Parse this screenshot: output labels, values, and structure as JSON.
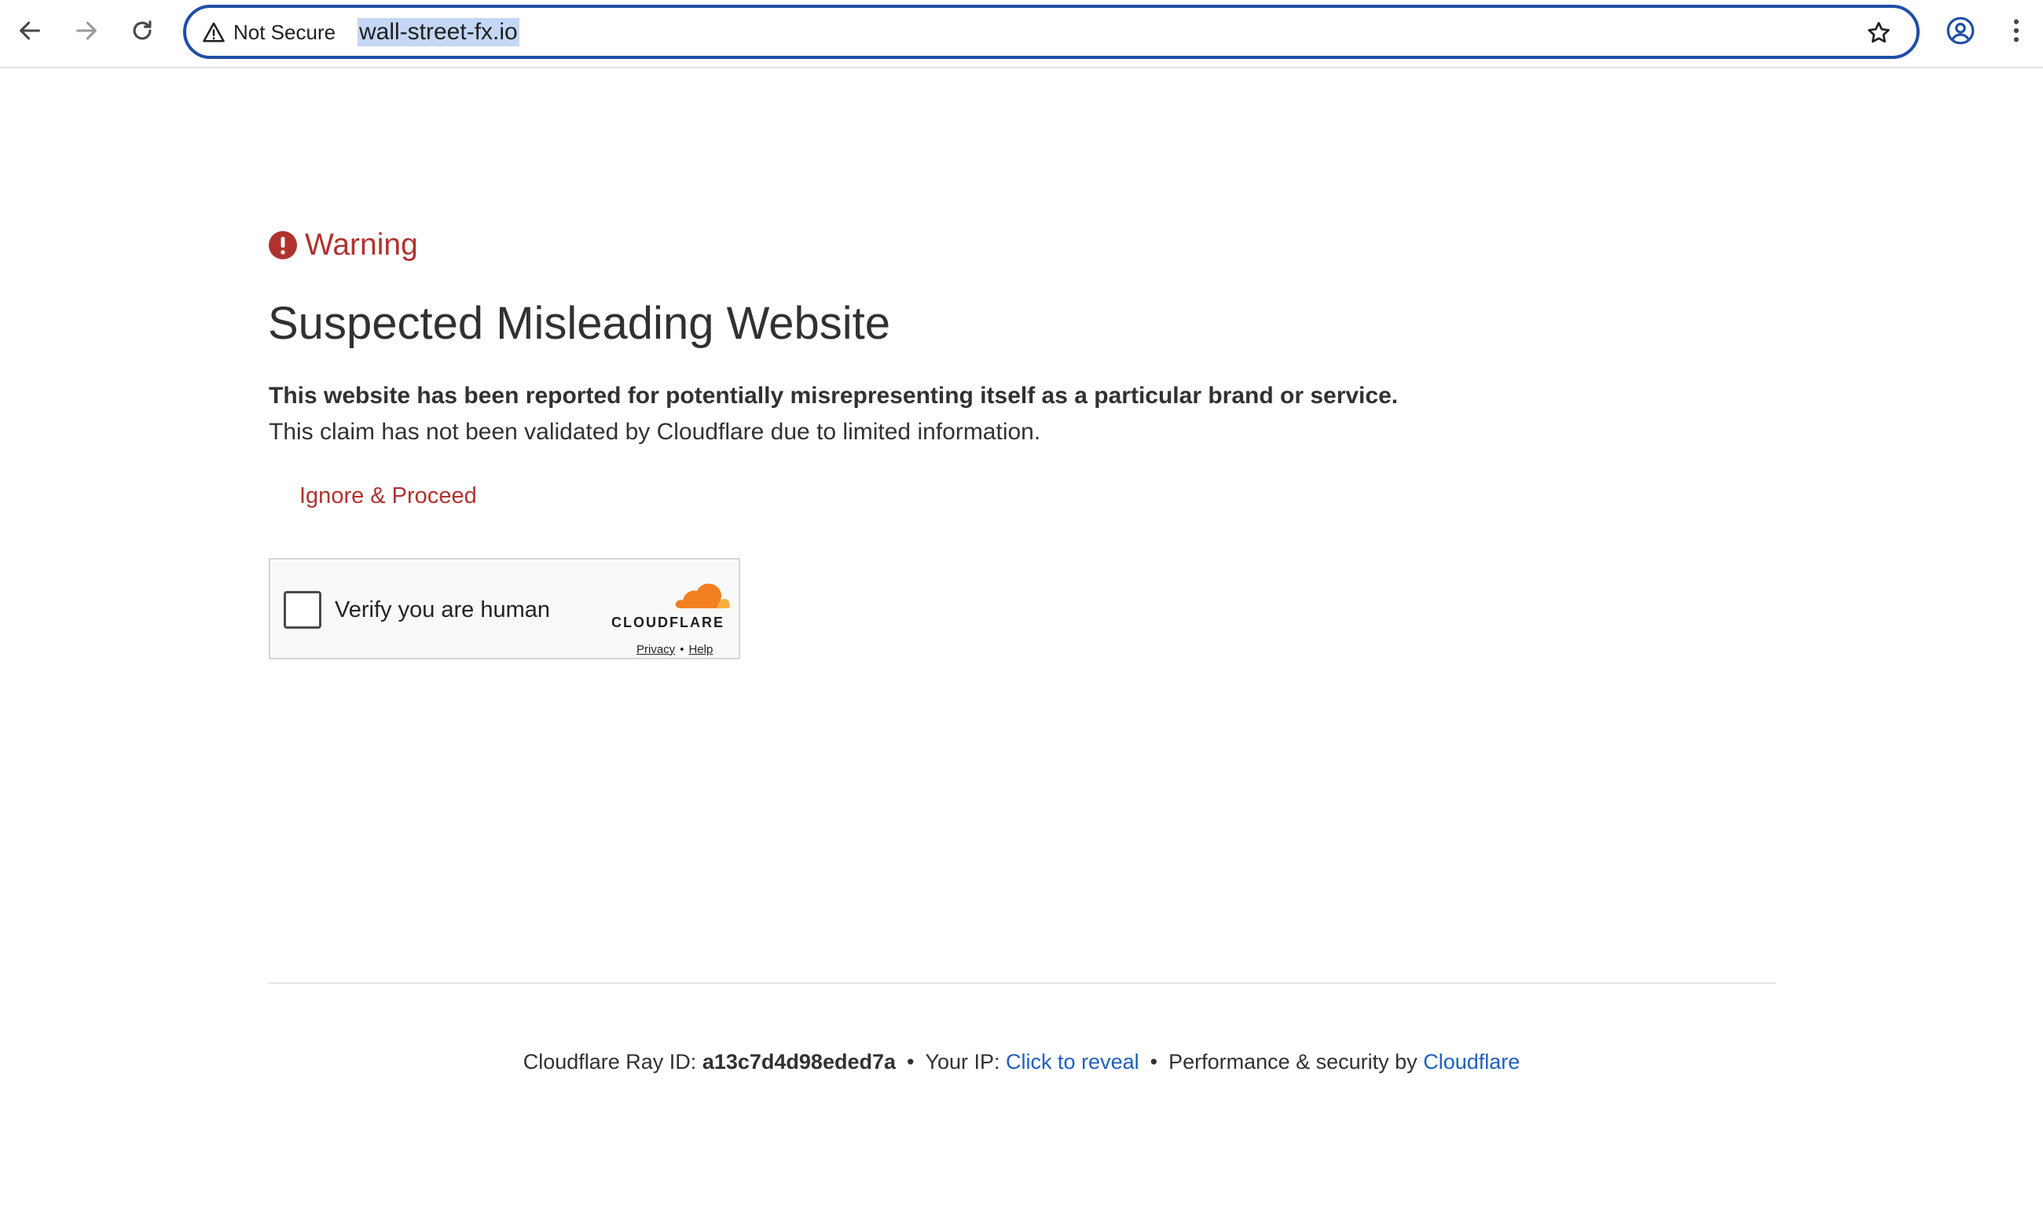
{
  "browser": {
    "security_label": "Not Secure",
    "url": "wall-street-fx.io"
  },
  "content": {
    "warning_label": "Warning",
    "title": "Suspected Misleading Website",
    "description_bold": "This website has been reported for potentially misrepresenting itself as a particular brand or service.",
    "description": "This claim has not been validated by Cloudflare due to limited information.",
    "proceed_link": "Ignore & Proceed"
  },
  "turnstile": {
    "label": "Verify you are human",
    "brand": "CLOUDFLARE",
    "privacy_link": "Privacy",
    "separator": "•",
    "help_link": "Help"
  },
  "footer": {
    "ray_label": "Cloudflare Ray ID:",
    "ray_id": "a13c7d4d98eded7a",
    "separator": "•",
    "ip_label": "Your IP:",
    "ip_link": "Click to reveal",
    "perf_label": "Performance & security by",
    "perf_link": "Cloudflare"
  },
  "colors": {
    "warning_red": "#b0322e",
    "link_blue": "#1f5fbf",
    "omnibox_border": "#1f4ea6",
    "cloudflare_orange": "#f38020"
  },
  "icons": {
    "back": "arrow-left-icon",
    "forward": "arrow-right-icon",
    "reload": "reload-icon",
    "security": "warning-triangle-icon",
    "bookmark": "star-icon",
    "profile": "profile-icon",
    "menu": "kebab-menu-icon",
    "warning": "exclamation-circle-icon",
    "cloud": "cloudflare-cloud-icon"
  }
}
